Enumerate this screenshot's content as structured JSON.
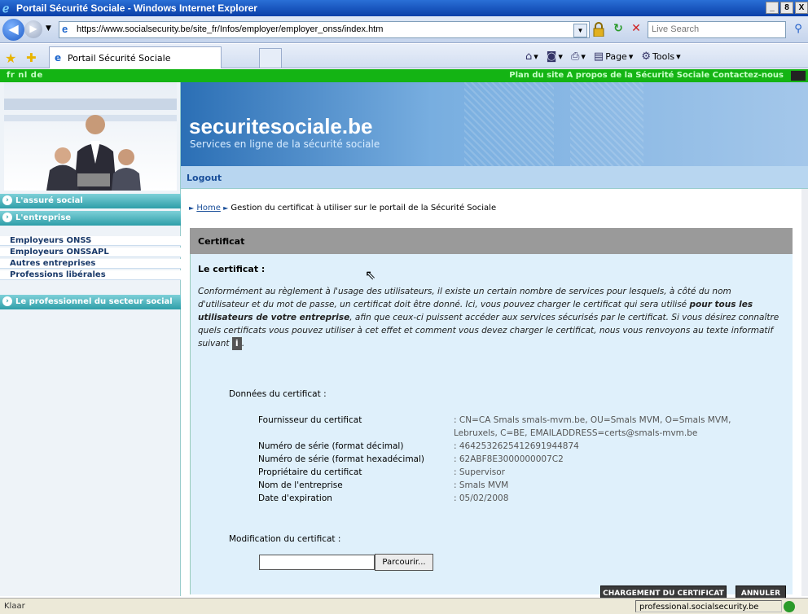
{
  "window": {
    "title": "Portail Sécurité Sociale - Windows Internet Explorer",
    "controls": [
      "_",
      "8",
      "X"
    ]
  },
  "address": {
    "url": "https://www.socialsecurity.be/site_fr/Infos/employer/employer_onss/index.htm",
    "search_placeholder": "Live Search"
  },
  "tab": {
    "label": "Portail Sécurité Sociale"
  },
  "commands": {
    "page": "Page",
    "tools": "Tools"
  },
  "site": {
    "languages": "fr  nl  de",
    "top_links": "Plan du site  A propos de la Sécurité Sociale  Contactez-nous",
    "brand": "securitesociale.be",
    "tagline": "Services en ligne de la sécurité sociale",
    "logout": "Logout"
  },
  "sidebar": {
    "items": [
      {
        "label": "L'assuré social"
      },
      {
        "label": "L'entreprise"
      }
    ],
    "subitems": [
      {
        "label": "Employeurs ONSS"
      },
      {
        "label": "Employeurs ONSSAPL"
      },
      {
        "label": "Autres entreprises"
      },
      {
        "label": "Professions libérales"
      }
    ],
    "last_item": {
      "label": "Le professionnel du secteur social"
    }
  },
  "breadcrumb": {
    "home": "Home",
    "current": "Gestion du certificat à utiliser sur le portail de la Sécurité Sociale"
  },
  "panel": {
    "header": "Certificat",
    "cert_label": "Le certificat :",
    "paragraph_1": "Conformément au règlement à l'usage des utilisateurs, il existe un certain nombre de services pour lesquels, à côté du nom d'utilisateur et du mot de passe, un certificat doit être donné. Ici, vous pouvez charger le certificat qui sera utilisé",
    "paragraph_bold": "pour tous les utilisateurs de votre entreprise",
    "paragraph_2": ", afin que ceux-ci puissent accéder aux services sécurisés par le certificat. Si vous désirez connaître quels certificats vous pouvez utiliser à cet effet et comment vous devez charger le certificat, nous vous renvoyons au texte informatif suivant",
    "info_icon": "i",
    "data_label": "Données du certificat :",
    "fields": [
      {
        "label": "Fournisseur du certificat",
        "value": ": CN=CA Smals smals-mvm.be, OU=Smals MVM, O=Smals MVM,",
        "value2": "Lebruxels, C=BE, EMAILADDRESS=certs@smals-mvm.be"
      },
      {
        "label": "Numéro de série (format décimal)",
        "value": ": 4642532625412691944874"
      },
      {
        "label": "Numéro de série (format hexadécimal)",
        "value": ": 62ABF8E3000000007C2"
      },
      {
        "label": "Propriétaire du certificat",
        "value": ": Supervisor"
      },
      {
        "label": "Nom de l'entreprise",
        "value": ": Smals MVM"
      },
      {
        "label": "Date d'expiration",
        "value": ": 05/02/2008"
      }
    ],
    "modify_label": "Modification du certificat :",
    "browse": "Parcourir...",
    "upload": "CHARGEMENT DU CERTIFICAT",
    "cancel": "ANNULER"
  },
  "status": {
    "text": "Klaar",
    "zone": "professional.socialsecurity.be"
  }
}
